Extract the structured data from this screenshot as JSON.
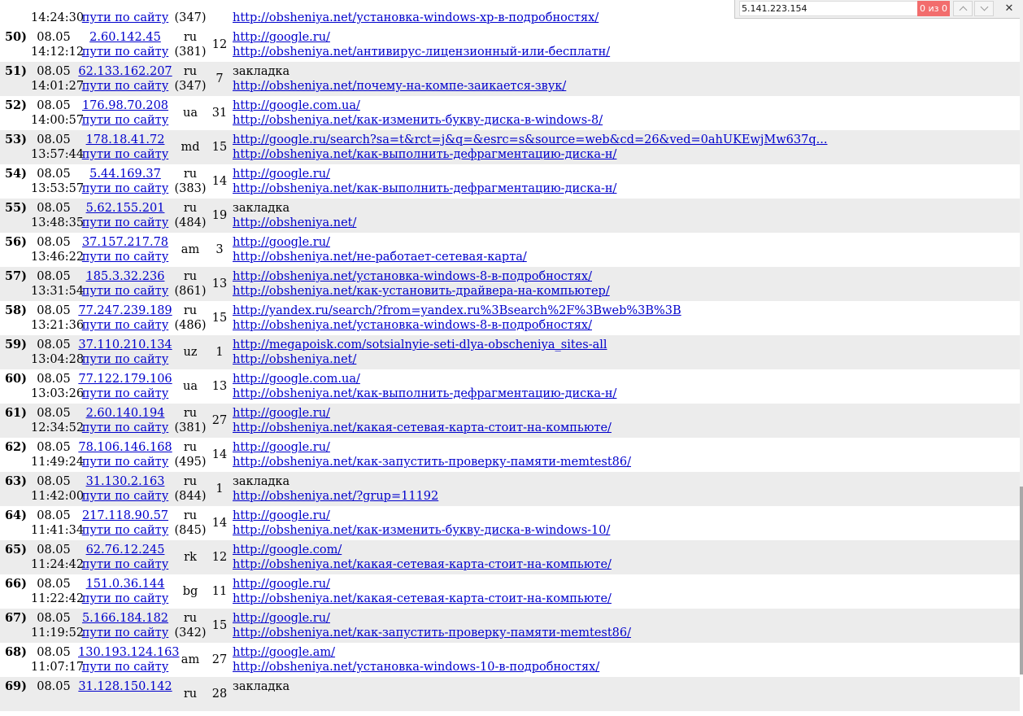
{
  "find_bar": {
    "query": "5.141.223.154",
    "match_count": "0 из 0",
    "close_glyph": "✕"
  },
  "visits": [
    {
      "num": "",
      "date": "",
      "time": "14:24:30",
      "ip": "",
      "paths": "пути по сайту",
      "country": "",
      "country_count": "(347)",
      "pages": "",
      "referrer": "",
      "referrer_is_link": false,
      "page_url": "http://obsheniya.net/установка-windows-xp-в-подробностях/",
      "alt": false
    },
    {
      "num": "50)",
      "date": "08.05",
      "time": "14:12:12",
      "ip": "2.60.142.45",
      "paths": "пути по сайту",
      "country": "ru",
      "country_count": "(381)",
      "pages": "12",
      "referrer": "http://google.ru/",
      "referrer_is_link": true,
      "page_url": "http://obsheniya.net/антивирус-лицензионный-или-бесплатн/",
      "alt": false
    },
    {
      "num": "51)",
      "date": "08.05",
      "time": "14:01:27",
      "ip": "62.133.162.207",
      "paths": "пути по сайту",
      "country": "ru",
      "country_count": "(347)",
      "pages": "7",
      "referrer": "закладка",
      "referrer_is_link": false,
      "page_url": "http://obsheniya.net/почему-на-компе-заикается-звук/",
      "alt": true
    },
    {
      "num": "52)",
      "date": "08.05",
      "time": "14:00:57",
      "ip": "176.98.70.208",
      "paths": "пути по сайту",
      "country": "ua",
      "country_count": "",
      "pages": "31",
      "referrer": "http://google.com.ua/",
      "referrer_is_link": true,
      "page_url": "http://obsheniya.net/как-изменить-букву-диска-в-windows-8/",
      "alt": false
    },
    {
      "num": "53)",
      "date": "08.05",
      "time": "13:57:44",
      "ip": "178.18.41.72",
      "paths": "пути по сайту",
      "country": "md",
      "country_count": "",
      "pages": "15",
      "referrer": "http://google.ru/search?sa=t&rct=j&q=&esrc=s&source=web&cd=26&ved=0ahUKEwjMw637q...",
      "referrer_is_link": true,
      "page_url": "http://obsheniya.net/как-выполнить-дефрагментацию-диска-н/",
      "alt": true
    },
    {
      "num": "54)",
      "date": "08.05",
      "time": "13:53:57",
      "ip": "5.44.169.37",
      "paths": "пути по сайту",
      "country": "ru",
      "country_count": "(383)",
      "pages": "14",
      "referrer": "http://google.ru/",
      "referrer_is_link": true,
      "page_url": "http://obsheniya.net/как-выполнить-дефрагментацию-диска-н/",
      "alt": false
    },
    {
      "num": "55)",
      "date": "08.05",
      "time": "13:48:35",
      "ip": "5.62.155.201",
      "paths": "пути по сайту",
      "country": "ru",
      "country_count": "(484)",
      "pages": "19",
      "referrer": "закладка",
      "referrer_is_link": false,
      "page_url": "http://obsheniya.net/",
      "alt": true
    },
    {
      "num": "56)",
      "date": "08.05",
      "time": "13:46:22",
      "ip": "37.157.217.78",
      "paths": "пути по сайту",
      "country": "am",
      "country_count": "",
      "pages": "3",
      "referrer": "http://google.ru/",
      "referrer_is_link": true,
      "page_url": "http://obsheniya.net/не-работает-сетевая-карта/",
      "alt": false
    },
    {
      "num": "57)",
      "date": "08.05",
      "time": "13:31:54",
      "ip": "185.3.32.236",
      "paths": "пути по сайту",
      "country": "ru",
      "country_count": "(861)",
      "pages": "13",
      "referrer": "http://obsheniya.net/установка-windows-8-в-подробностях/",
      "referrer_is_link": true,
      "page_url": "http://obsheniya.net/как-установить-драйвера-на-компьютер/",
      "alt": true
    },
    {
      "num": "58)",
      "date": "08.05",
      "time": "13:21:36",
      "ip": "77.247.239.189",
      "paths": "пути по сайту",
      "country": "ru",
      "country_count": "(486)",
      "pages": "15",
      "referrer": "http://yandex.ru/search/?from=yandex.ru%3Bsearch%2F%3Bweb%3B%3B",
      "referrer_is_link": true,
      "page_url": "http://obsheniya.net/установка-windows-8-в-подробностях/",
      "alt": false
    },
    {
      "num": "59)",
      "date": "08.05",
      "time": "13:04:28",
      "ip": "37.110.210.134",
      "paths": "пути по сайту",
      "country": "uz",
      "country_count": "",
      "pages": "1",
      "referrer": "http://megapoisk.com/sotsialnyie-seti-dlya-obscheniya_sites-all",
      "referrer_is_link": true,
      "page_url": "http://obsheniya.net/",
      "alt": true
    },
    {
      "num": "60)",
      "date": "08.05",
      "time": "13:03:26",
      "ip": "77.122.179.106",
      "paths": "пути по сайту",
      "country": "ua",
      "country_count": "",
      "pages": "13",
      "referrer": "http://google.com.ua/",
      "referrer_is_link": true,
      "page_url": "http://obsheniya.net/как-выполнить-дефрагментацию-диска-н/",
      "alt": false
    },
    {
      "num": "61)",
      "date": "08.05",
      "time": "12:34:52",
      "ip": "2.60.140.194",
      "paths": "пути по сайту",
      "country": "ru",
      "country_count": "(381)",
      "pages": "27",
      "referrer": "http://google.ru/",
      "referrer_is_link": true,
      "page_url": "http://obsheniya.net/какая-сетевая-карта-стоит-на-компьюте/",
      "alt": true
    },
    {
      "num": "62)",
      "date": "08.05",
      "time": "11:49:24",
      "ip": "78.106.146.168",
      "paths": "пути по сайту",
      "country": "ru",
      "country_count": "(495)",
      "pages": "14",
      "referrer": "http://google.ru/",
      "referrer_is_link": true,
      "page_url": "http://obsheniya.net/как-запустить-проверку-памяти-memtest86/",
      "alt": false
    },
    {
      "num": "63)",
      "date": "08.05",
      "time": "11:42:00",
      "ip": "31.130.2.163",
      "paths": "пути по сайту",
      "country": "ru",
      "country_count": "(844)",
      "pages": "1",
      "referrer": "закладка",
      "referrer_is_link": false,
      "page_url": "http://obsheniya.net/?grup=11192",
      "alt": true
    },
    {
      "num": "64)",
      "date": "08.05",
      "time": "11:41:34",
      "ip": "217.118.90.57",
      "paths": "пути по сайту",
      "country": "ru",
      "country_count": "(845)",
      "pages": "14",
      "referrer": "http://google.ru/",
      "referrer_is_link": true,
      "page_url": "http://obsheniya.net/как-изменить-букву-диска-в-windows-10/",
      "alt": false
    },
    {
      "num": "65)",
      "date": "08.05",
      "time": "11:24:42",
      "ip": "62.76.12.245",
      "paths": "пути по сайту",
      "country": "rk",
      "country_count": "",
      "pages": "12",
      "referrer": "http://google.com/",
      "referrer_is_link": true,
      "page_url": "http://obsheniya.net/какая-сетевая-карта-стоит-на-компьюте/",
      "alt": true
    },
    {
      "num": "66)",
      "date": "08.05",
      "time": "11:22:42",
      "ip": "151.0.36.144",
      "paths": "пути по сайту",
      "country": "bg",
      "country_count": "",
      "pages": "11",
      "referrer": "http://google.ru/",
      "referrer_is_link": true,
      "page_url": "http://obsheniya.net/какая-сетевая-карта-стоит-на-компьюте/",
      "alt": false
    },
    {
      "num": "67)",
      "date": "08.05",
      "time": "11:19:52",
      "ip": "5.166.184.182",
      "paths": "пути по сайту",
      "country": "ru",
      "country_count": "(342)",
      "pages": "15",
      "referrer": "http://google.ru/",
      "referrer_is_link": true,
      "page_url": "http://obsheniya.net/как-запустить-проверку-памяти-memtest86/",
      "alt": true
    },
    {
      "num": "68)",
      "date": "08.05",
      "time": "11:07:17",
      "ip": "130.193.124.163",
      "paths": "пути по сайту",
      "country": "am",
      "country_count": "",
      "pages": "27",
      "referrer": "http://google.am/",
      "referrer_is_link": true,
      "page_url": "http://obsheniya.net/установка-windows-10-в-подробностях/",
      "alt": false
    },
    {
      "num": "69)",
      "date": "08.05",
      "time": "",
      "ip": "31.128.150.142",
      "paths": "",
      "country": "ru",
      "country_count": "",
      "pages": "28",
      "referrer": "закладка",
      "referrer_is_link": false,
      "page_url": "",
      "alt": true
    }
  ]
}
